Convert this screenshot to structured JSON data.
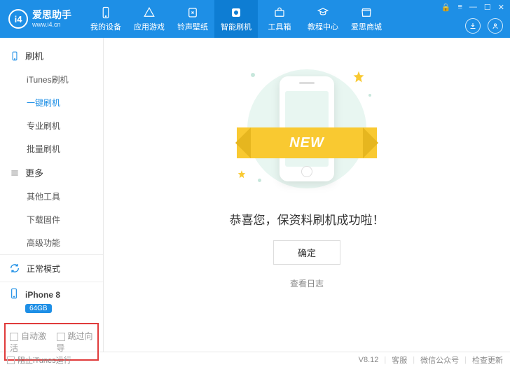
{
  "app": {
    "name": "爱思助手",
    "url": "www.i4.cn",
    "logo_text": "i4"
  },
  "win_ctrl": {
    "lock": "🔒",
    "menu": "≡",
    "min": "—",
    "max": "☐",
    "close": "✕"
  },
  "tabs": [
    {
      "id": "device",
      "label": "我的设备"
    },
    {
      "id": "apps",
      "label": "应用游戏"
    },
    {
      "id": "ring",
      "label": "铃声壁纸"
    },
    {
      "id": "flash",
      "label": "智能刷机",
      "active": true
    },
    {
      "id": "tools",
      "label": "工具箱"
    },
    {
      "id": "tutorial",
      "label": "教程中心"
    },
    {
      "id": "mall",
      "label": "爱思商城"
    }
  ],
  "sidebar": {
    "group1": {
      "title": "刷机",
      "items": [
        {
          "label": "iTunes刷机"
        },
        {
          "label": "一键刷机",
          "active": true
        },
        {
          "label": "专业刷机"
        },
        {
          "label": "批量刷机"
        }
      ]
    },
    "group2": {
      "title": "更多",
      "items": [
        {
          "label": "其他工具"
        },
        {
          "label": "下载固件"
        },
        {
          "label": "高级功能"
        }
      ]
    },
    "mode": "正常模式",
    "device": {
      "name": "iPhone 8",
      "storage": "64GB"
    },
    "opts": {
      "auto_activate": "自动激活",
      "skip_guide": "跳过向导"
    }
  },
  "main": {
    "ribbon": "NEW",
    "message": "恭喜您，保资料刷机成功啦！",
    "ok": "确定",
    "log": "查看日志"
  },
  "footer": {
    "block_itunes": "阻止iTunes运行",
    "version": "V8.12",
    "support": "客服",
    "wechat": "微信公众号",
    "update": "检查更新"
  }
}
